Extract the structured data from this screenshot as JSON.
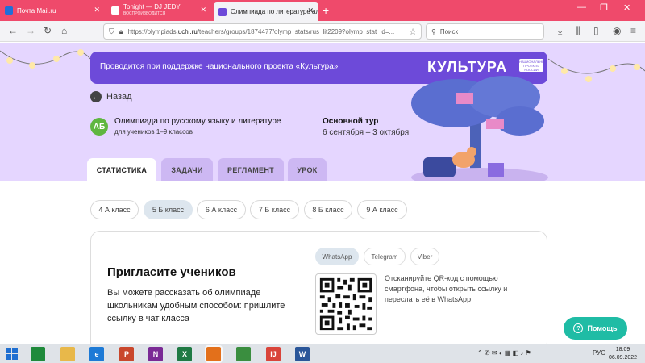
{
  "browser": {
    "tabs": [
      {
        "title": "Почта Mail.ru",
        "subtitle": "",
        "active": false,
        "favicon_color": "#1e6fd9"
      },
      {
        "title": "Tonight — DJ JEDY",
        "subtitle": "ВОСПРОИЗВОДИТСЯ",
        "active": false,
        "favicon_color": "#ffffff"
      },
      {
        "title": "Олимпиада по литературе ал",
        "subtitle": "",
        "active": true,
        "favicon_color": "#6d4ad9"
      }
    ],
    "new_tab_label": "+",
    "window_controls": [
      "—",
      "❐",
      "✕"
    ],
    "url_host": "https://olympiads.",
    "url_domain": "uchi.ru",
    "url_path": "/teachers/groups/1874477/olymp_stats/rus_lit2209?olymp_stat_id=...",
    "search_placeholder": "Поиск"
  },
  "page": {
    "banner_text": "Проводится при поддержке национального проекта «Культура»",
    "banner_logo": "КУЛЬТУРА",
    "banner_flag_text": "НАЦИОНАЛЬНЫЕ ПРОЕКТЫ РОССИИ",
    "back_label": "Назад",
    "olympiad_icon": "АБ",
    "olympiad_title": "Олимпиада по русскому языку и литературе",
    "olympiad_subtitle": "для учеников 1–9 классов",
    "round_title": "Основной тур",
    "round_dates": "6 сентября – 3 октября",
    "tabs": [
      "СТАТИСТИКА",
      "ЗАДАЧИ",
      "РЕГЛАМЕНТ",
      "УРОК"
    ],
    "active_tab": "СТАТИСТИКА",
    "classes": [
      "4 А класс",
      "5 Б класс",
      "6 А класс",
      "7 Б класс",
      "8 Б класс",
      "9 А класс"
    ],
    "active_class": "5 Б класс",
    "invite": {
      "title": "Пригласите учеников",
      "text": "Вы можете рассказать об олимпиаде школьникам удобным способом: пришлите ссылку в чат класса",
      "messengers": [
        "WhatsApp",
        "Telegram",
        "Viber"
      ],
      "active_messenger": "WhatsApp",
      "qr_text": "Отсканируйте QR-код с помощью смартфона, чтобы открыть ссылку и переслать её в WhatsApp"
    },
    "help_label": "Помощь"
  },
  "taskbar": {
    "apps": [
      {
        "name": "excel-green",
        "label": "",
        "color": "#1f8a3b"
      },
      {
        "name": "file-explorer",
        "label": "",
        "color": "#e8b84a"
      },
      {
        "name": "internet-explorer",
        "label": "e",
        "color": "#1d7ad6"
      },
      {
        "name": "powerpoint",
        "label": "P",
        "color": "#c9472c"
      },
      {
        "name": "onenote",
        "label": "N",
        "color": "#7a2a95"
      },
      {
        "name": "excel",
        "label": "X",
        "color": "#1f7a44"
      },
      {
        "name": "firefox",
        "label": "",
        "color": "#e3701b"
      },
      {
        "name": "chrome",
        "label": "",
        "color": "#3a8e3f"
      },
      {
        "name": "app-red",
        "label": "IJ",
        "color": "#d9443a"
      },
      {
        "name": "word",
        "label": "W",
        "color": "#2a5699"
      }
    ],
    "lang": "РУС",
    "time": "18:09",
    "date": "06.09.2022"
  },
  "colors": {
    "browser_accent": "#ef4a6b",
    "hero_bg": "#e5d6ff",
    "banner_bg": "#6d4ad9",
    "help_bg": "#1fbca5"
  }
}
